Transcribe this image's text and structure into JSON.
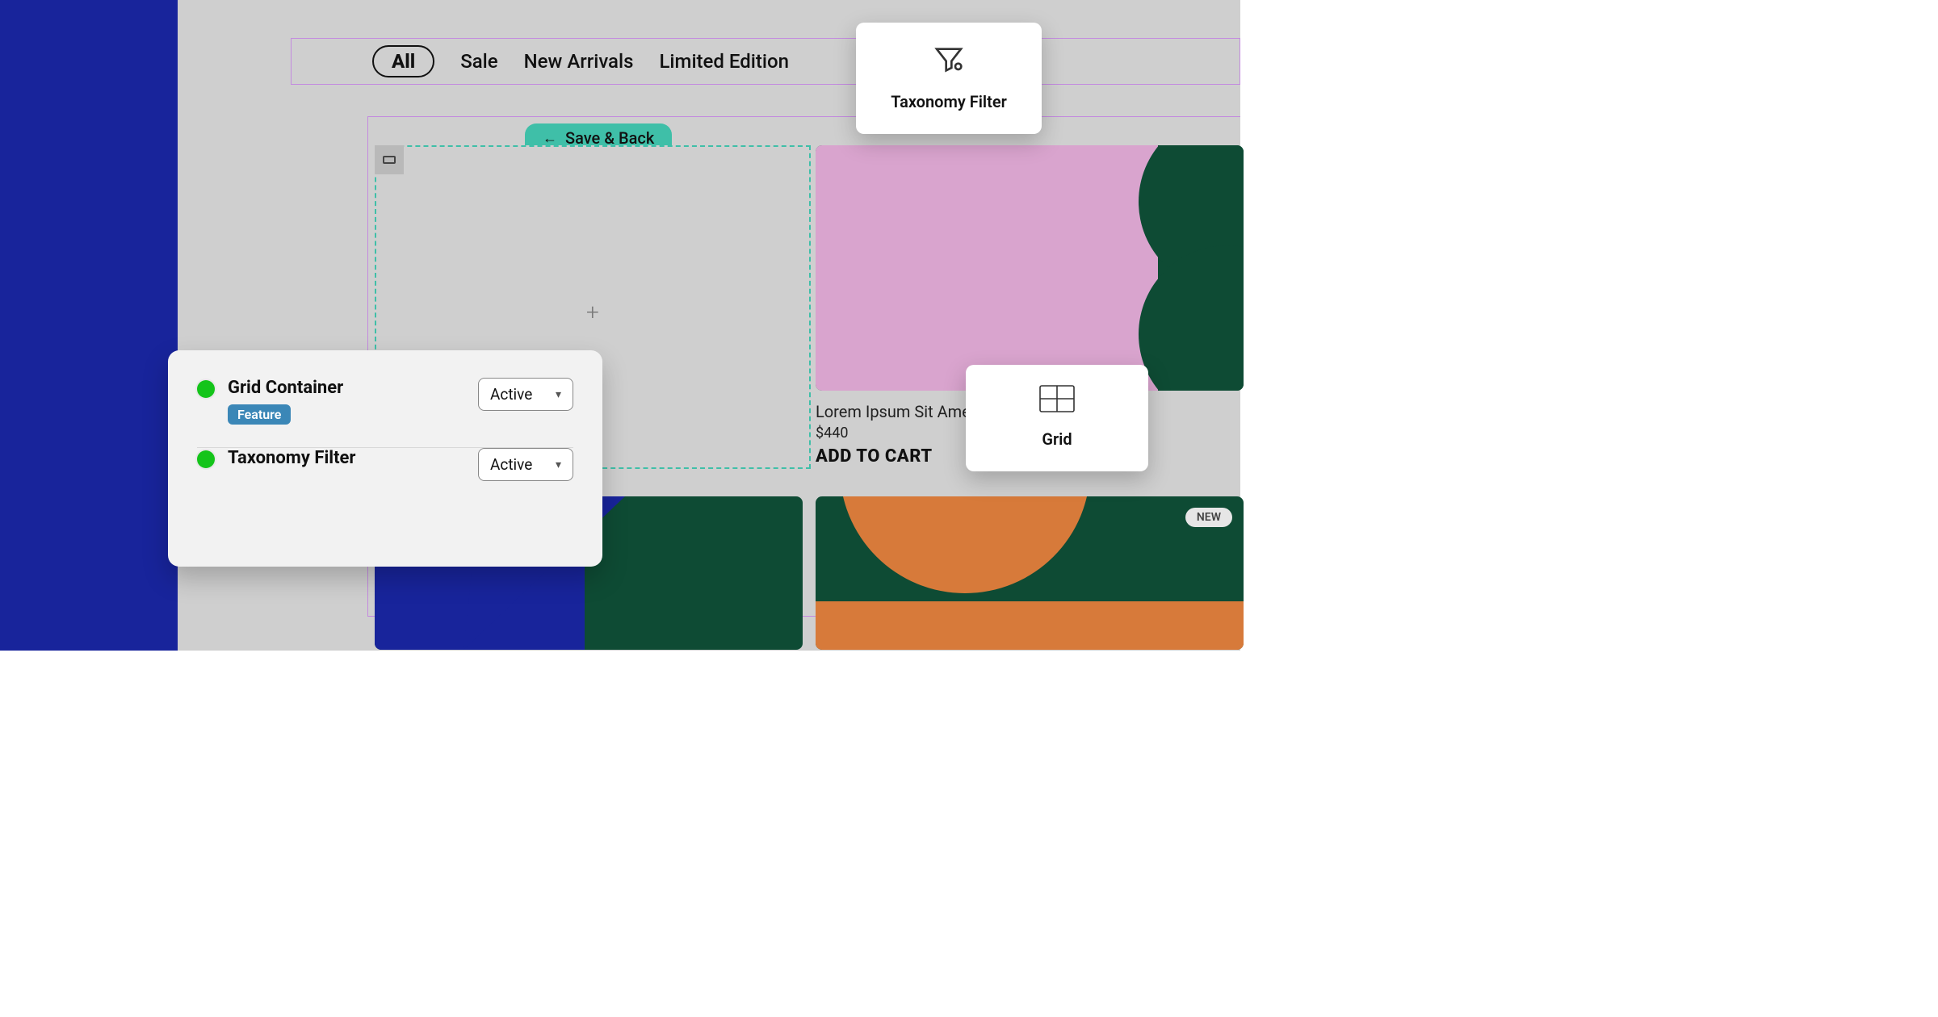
{
  "nav": {
    "all": "All",
    "sale": "Sale",
    "new_arrivals": "New Arrivals",
    "limited": "Limited Edition"
  },
  "editor": {
    "save_back": "Save & Back"
  },
  "product": {
    "title": "Lorem Ipsum Sit Amet",
    "price": "$440",
    "add_to_cart": "ADD TO CART"
  },
  "badge": {
    "new": "NEW"
  },
  "popover": {
    "taxonomy_filter": "Taxonomy Filter",
    "grid": "Grid"
  },
  "settings": {
    "grid_container": {
      "title": "Grid Container",
      "badge": "Feature",
      "state": "Active"
    },
    "taxonomy_filter": {
      "title": "Taxonomy Filter",
      "state": "Active"
    }
  }
}
